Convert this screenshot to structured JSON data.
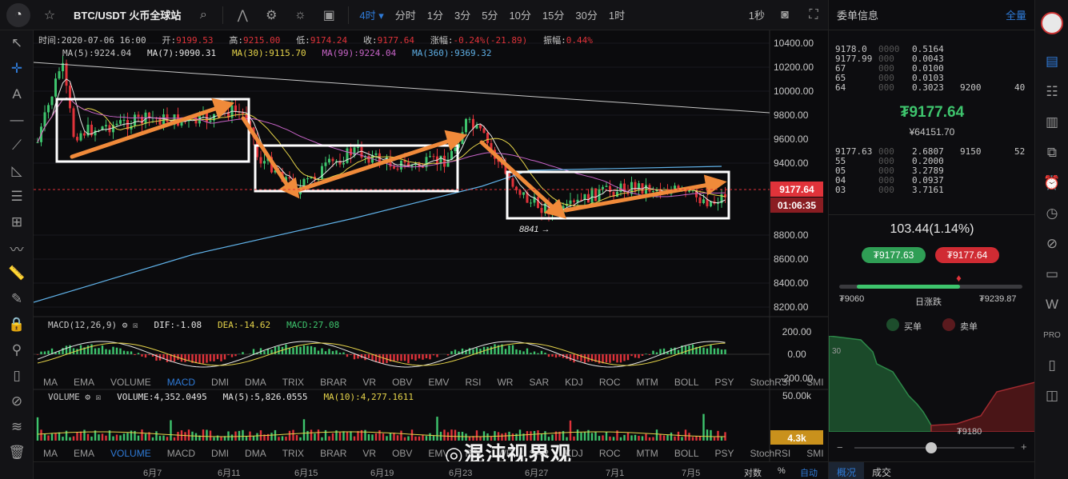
{
  "topbar": {
    "pair": "BTC/USDT 火币全球站",
    "active_interval": "4时",
    "intervals": [
      "分时",
      "1分",
      "3分",
      "5分",
      "10分",
      "15分",
      "30分",
      "1时"
    ],
    "right_label": "1秒",
    "icons": [
      "search-icon",
      "indicator-icon",
      "settings-icon",
      "theme-icon",
      "layout-icon",
      "camera-icon",
      "fullscreen-icon"
    ]
  },
  "info": {
    "time_label": "时间:",
    "time": "2020-07-06 16:00",
    "open_label": "开:",
    "open": "9199.53",
    "high_label": "高:",
    "high": "9215.00",
    "low_label": "低:",
    "low": "9174.24",
    "close_label": "收:",
    "close": "9177.64",
    "chg_label": "涨幅:",
    "chg": "-0.24%(-21.89)",
    "amp_label": "振幅:",
    "amp": "0.44%"
  },
  "ma_line": {
    "ma_main": "MA(5):9224.04",
    "ma7": "MA(7):9090.31",
    "ma30": "MA(30):9115.70",
    "ma99": "MA(99):9224.04",
    "ma360": "MA(360):9369.32"
  },
  "macd_line": {
    "title": "MACD(12,26,9)",
    "dif": "DIF:-1.08",
    "dea": "DEA:-14.62",
    "macd": "MACD:27.08"
  },
  "volume_line": {
    "title": "VOLUME",
    "vol": "VOLUME:4,352.0495",
    "ma5": "MA(5):5,826.0555",
    "ma10": "MA(10):4,277.1611"
  },
  "price_axis": [
    "10400.00",
    "10200.00",
    "10000.00",
    "9800.00",
    "9600.00",
    "9400.00",
    "8800.00",
    "8600.00",
    "8400.00",
    "8200.00"
  ],
  "current_price_tag": "9177.64",
  "countdown_tag": "01:06:35",
  "low_annotation": "8841 →",
  "macd_axis": [
    "200.00",
    "0.00",
    "-200.00"
  ],
  "vol_axis": [
    "50.00k",
    "4.3k"
  ],
  "indicators_row1": [
    "MA",
    "EMA",
    "VOLUME",
    "MACD",
    "DMI",
    "DMA",
    "TRIX",
    "BRAR",
    "VR",
    "OBV",
    "EMV",
    "RSI",
    "WR",
    "SAR",
    "KDJ",
    "ROC",
    "MTM",
    "BOLL",
    "PSY",
    "StochRSI",
    "SMI",
    "CCI",
    "MFI",
    "ATR",
    "BBW"
  ],
  "indicators_row1_active": "MACD",
  "indicators_row2": [
    "MA",
    "EMA",
    "VOLUME",
    "MACD",
    "DMI",
    "DMA",
    "TRIX",
    "BRAR",
    "VR",
    "OBV",
    "EMV",
    "RSI",
    "WR",
    "SAR",
    "KDJ",
    "ROC",
    "MTM",
    "BOLL",
    "PSY",
    "StochRSI",
    "SMI",
    "CCI",
    "MFI",
    "ATR",
    "BBW"
  ],
  "indicators_row2_active": "VOLUME",
  "date_axis": [
    "6月7",
    "6月11",
    "6月15",
    "6月19",
    "6月23",
    "6月27",
    "7月1",
    "7月5"
  ],
  "bottom_right": {
    "log": "对数",
    "pct": "%",
    "auto": "自动"
  },
  "watermark": "混沌视界观",
  "orderbook": {
    "title": "委单信息",
    "full": "全量",
    "asks": [
      {
        "p": "9178.0",
        "p2": "0000",
        "q": "0.5164",
        "s": "",
        "t": ""
      },
      {
        "p": "9177.99",
        "p2": "000",
        "q": "0.0043",
        "s": "",
        "t": ""
      },
      {
        "p": "67",
        "p2": "000",
        "q": "0.0100",
        "s": "",
        "t": ""
      },
      {
        "p": "65",
        "p2": "000",
        "q": "0.0103",
        "s": "",
        "t": ""
      },
      {
        "p": "64",
        "p2": "000",
        "q": "0.3023",
        "s": "9200",
        "t": "40"
      }
    ],
    "mid_price": "₮9177.64",
    "mid_sub": "¥64151.70",
    "bids": [
      {
        "p": "9177.63",
        "p2": "000",
        "q": "2.6807",
        "s": "9150",
        "t": "52"
      },
      {
        "p": "55",
        "p2": "000",
        "q": "0.2000",
        "s": "",
        "t": ""
      },
      {
        "p": "05",
        "p2": "000",
        "q": "3.2789",
        "s": "",
        "t": ""
      },
      {
        "p": "04",
        "p2": "000",
        "q": "0.0937",
        "s": "",
        "t": ""
      },
      {
        "p": "03",
        "p2": "000",
        "q": "3.7161",
        "s": "",
        "t": ""
      }
    ],
    "change": "103.44(1.14%)",
    "buy_price": "₮9177.63",
    "sell_price": "₮9177.64",
    "range_low": "₮9060",
    "range_label": "日涨跌",
    "range_high": "₮9239.87",
    "range_fraction": 0.66,
    "legend_buy": "买单",
    "legend_sell": "卖单",
    "depth_axis": "30",
    "depth_price": "₮9180"
  },
  "bottom_tabs": [
    "概况",
    "成交"
  ],
  "colors": {
    "up": "#3ec46d",
    "down": "#e0333a",
    "accent": "#2f7bd8",
    "box": "#ffffff",
    "arrow": "#f08a3a"
  }
}
